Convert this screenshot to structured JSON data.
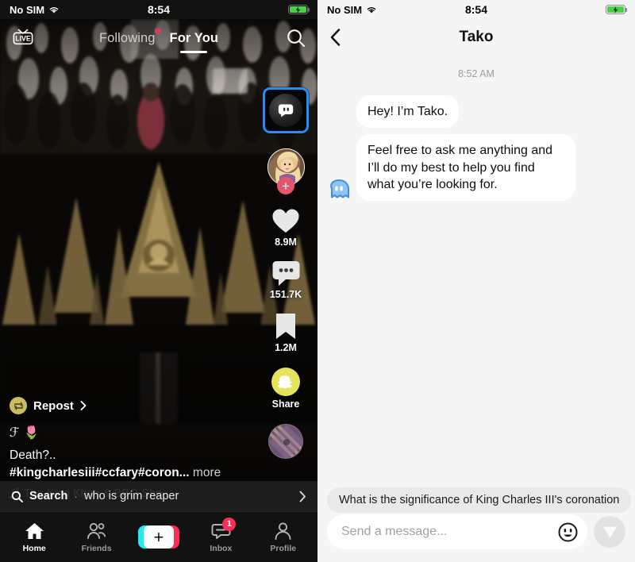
{
  "status_bar": {
    "carrier": "No SIM",
    "time": "8:54",
    "wifi_icon": "wifi-icon",
    "battery_icon": "battery-charging-icon"
  },
  "tiktok": {
    "live_button_label": "LIVE",
    "tabs": [
      {
        "label": "Following",
        "active": false,
        "has_dot": true
      },
      {
        "label": "For You",
        "active": true,
        "has_dot": false
      }
    ],
    "search_icon": "search-icon",
    "actions": {
      "tako_icon": "tako-ai-icon",
      "tako_selected": true,
      "avatar_icon": "creator-avatar",
      "follow_label": "+",
      "like_icon": "heart-icon",
      "like_count": "8.9M",
      "comment_icon": "comment-icon",
      "comment_count": "151.7K",
      "bookmark_icon": "bookmark-icon",
      "bookmark_count": "1.2M",
      "share_icon": "snapchat-icon",
      "share_label": "Share",
      "disc_icon": "music-disc-icon"
    },
    "caption": {
      "repost_icon": "repost-icon",
      "repost_label": "Repost",
      "repost_chevron": "chevron-right-icon",
      "username": "ℱ 🌷",
      "text": "Death?..",
      "hashtags": "#kingcharlesiii#ccfary#coron...",
      "more_label": "more",
      "music_icon": "music-note-icon",
      "music_title": "The King Khan & BBQ Sho"
    },
    "search_bar": {
      "icon": "search-icon",
      "label": "Search",
      "separator": "·",
      "query": "who is grim reaper",
      "chevron": "chevron-right-icon"
    },
    "bottom_nav": [
      {
        "label": "Home",
        "icon": "home-icon",
        "active": true,
        "badge": ""
      },
      {
        "label": "Friends",
        "icon": "friends-icon",
        "active": false,
        "badge": ""
      },
      {
        "label": "",
        "icon": "create-plus-icon",
        "active": false,
        "badge": ""
      },
      {
        "label": "Inbox",
        "icon": "inbox-icon",
        "active": false,
        "badge": "1"
      },
      {
        "label": "Profile",
        "icon": "profile-icon",
        "active": false,
        "badge": ""
      }
    ]
  },
  "chat": {
    "back_icon": "chevron-left-icon",
    "title": "Tako",
    "timestamp": "8:52 AM",
    "avatar_icon": "tako-avatar-icon",
    "messages": [
      {
        "sender": "tako",
        "text": "Hey! I’m Tako."
      },
      {
        "sender": "tako",
        "text": "Feel free to ask me anything and I’ll do my best to help you find what you’re looking for."
      }
    ],
    "suggestion": "What is the significance of King Charles III's coronation",
    "composer": {
      "placeholder": "Send a message...",
      "value": "",
      "emoji_icon": "emoji-smiley-icon",
      "send_icon": "send-icon",
      "send_disabled": true
    }
  },
  "colors": {
    "tiktok_bg": "#121212",
    "chat_bg": "#f5f5f5",
    "accent_blue": "#1f8fff",
    "accent_red": "#fd2c55",
    "accent_cyan": "#26e8ef",
    "snap_yellow": "#e3e35c",
    "badge_red": "#d0405a",
    "tako_blue": "#4a9eea"
  }
}
